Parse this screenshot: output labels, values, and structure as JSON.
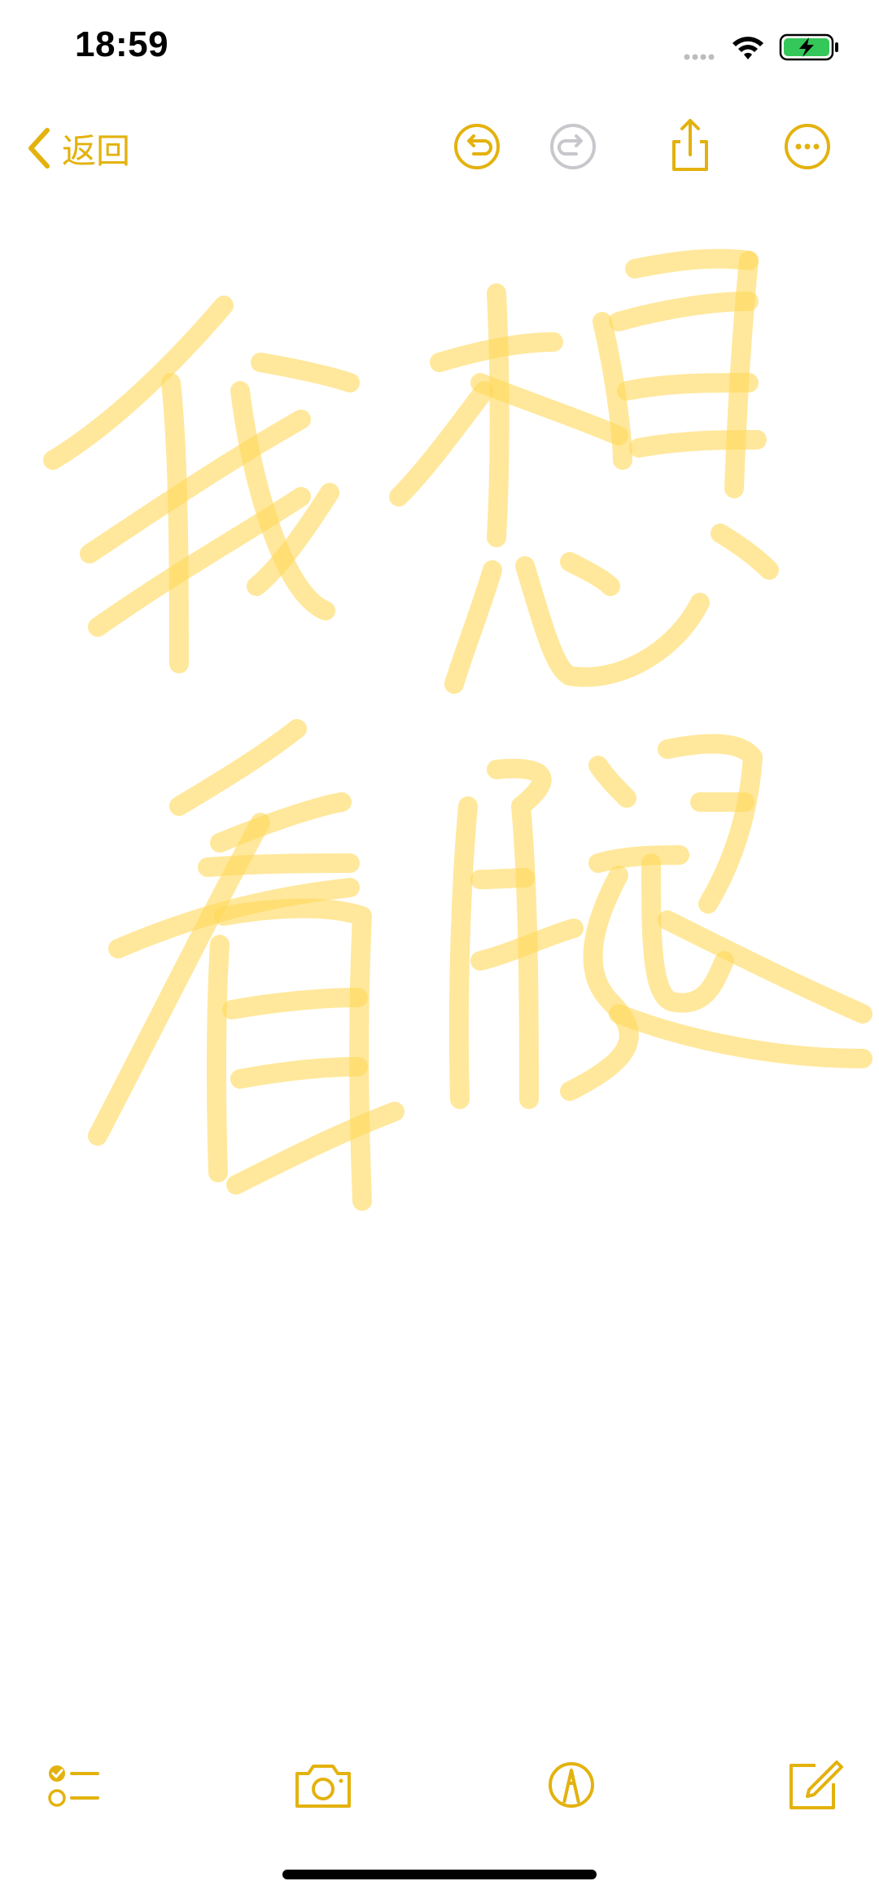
{
  "status_bar": {
    "time": "18:59"
  },
  "nav": {
    "back_label": "返回"
  },
  "colors": {
    "accent": "#E3B20E",
    "ink": "#FFD95A",
    "disabled": "#C7C7CC",
    "battery": "#34C759"
  },
  "icons": {
    "back": "chevron-left-icon",
    "undo": "undo-icon",
    "redo": "redo-icon",
    "share": "share-icon",
    "more": "ellipsis-circle-icon",
    "checklist": "checklist-icon",
    "camera": "camera-icon",
    "markup": "markup-pen-icon",
    "compose": "compose-icon"
  }
}
